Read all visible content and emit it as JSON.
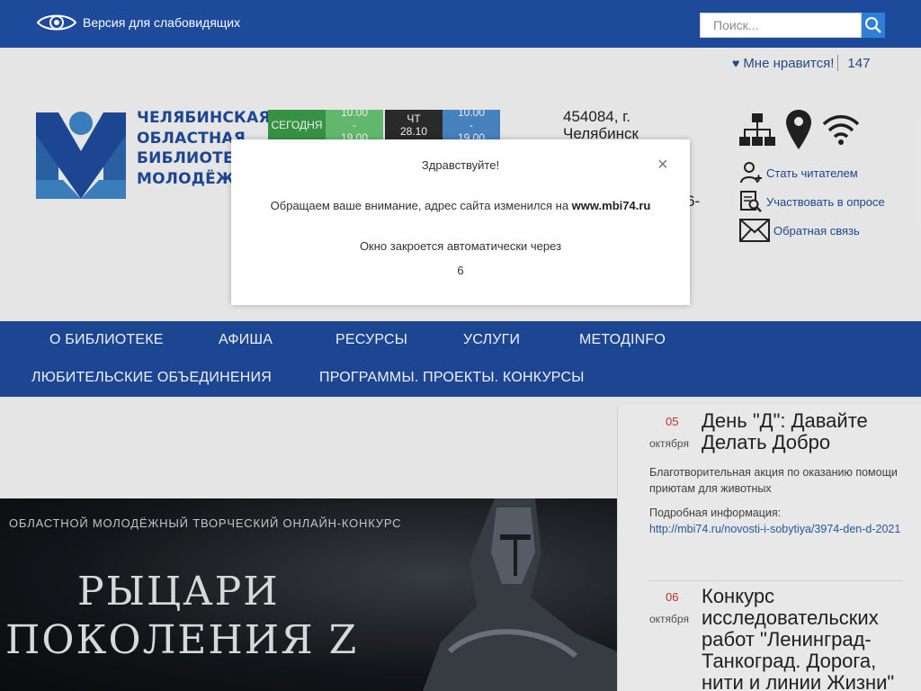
{
  "topbar": {
    "vision_label": "Версия для слабовидящих",
    "search_placeholder": "Поиск..."
  },
  "likes": {
    "label": "Мне нравится!",
    "count": "147"
  },
  "logo": {
    "lines": [
      "ЧЕЛЯБИНСКАЯ",
      "ОБЛАСТНАЯ",
      "БИБЛИОТЕКА",
      "МОЛОДЁЖИ"
    ]
  },
  "weather": {
    "today_label": "СЕГОДНЯ",
    "range1": [
      "10.00",
      "-",
      "19.00"
    ],
    "day_label": "ЧТ",
    "day_date": "28.10",
    "range2": [
      "10.00",
      "-",
      "19.00"
    ]
  },
  "address": {
    "line1": "454084, г.",
    "line2": "Челябинск",
    "line3": "6-"
  },
  "actions": {
    "become_reader": "Стать читателем",
    "survey": "Участвовать в опросе",
    "feedback": "Обратная связь"
  },
  "nav": {
    "items": [
      "О БИБЛИОТЕКЕ",
      "АФИША",
      "РЕСУРСЫ",
      "УСЛУГИ",
      "МЕТОДINFO",
      "ЛЮБИТЕЛЬСКИЕ ОБЪЕДИНЕНИЯ",
      "ПРОГРАММЫ. ПРОЕКТЫ. КОНКУРСЫ"
    ]
  },
  "banner": {
    "subtitle": "ОБЛАСТНОЙ МОЛОДЁЖНЫЙ ТВОРЧЕСКИЙ ОНЛАЙН-КОНКУРС",
    "title_line1": "РЫЦАРИ",
    "title_line2": "ПОКОЛЕНИЯ Z"
  },
  "news": [
    {
      "day": "05",
      "month": "октября",
      "title": "День \"Д\": Давайте Делать Добро",
      "text": "Благотворительная акция по оказанию помощи приютам для животных",
      "more_label": "Подробная информация:",
      "link": "http://mbi74.ru/novosti-i-sobytiya/3974-den-d-2021"
    },
    {
      "day": "06",
      "month": "октября",
      "title": "Конкурс исследовательских работ \"Ленинград-Танкоград. Дорога, нити и линии Жизни\""
    }
  ],
  "modal": {
    "greeting": "Здравствуйте!",
    "close_symbol": "×",
    "message_prefix": "Обращаем ваше внимание, адрес сайта изменился на ",
    "new_url": "www.mbi74.ru",
    "auto_close": "Окно закроется автоматически через",
    "countdown": "6"
  },
  "colors": {
    "primary": "#1e4a9c",
    "accent_red": "#c0392b",
    "link": "#2a5ca8"
  }
}
